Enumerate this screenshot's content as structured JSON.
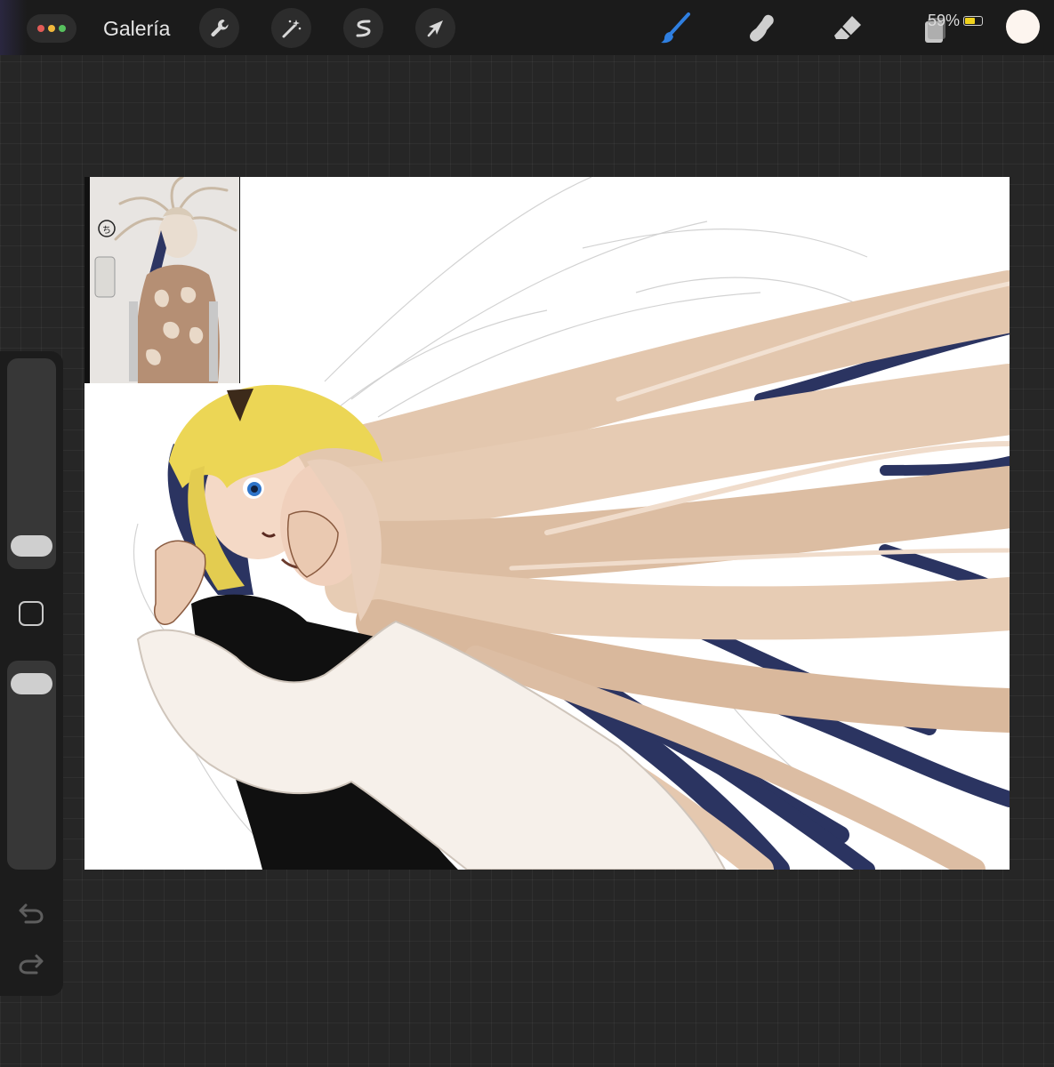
{
  "toolbar": {
    "gallery_label": "Galería",
    "menu_dots": [
      "#e25b57",
      "#f1b83c",
      "#57c15e"
    ],
    "left_tools": [
      {
        "name": "actions",
        "icon": "wrench-icon"
      },
      {
        "name": "adjustments",
        "icon": "magic-wand-icon"
      },
      {
        "name": "selection",
        "icon": "selection-s-icon"
      },
      {
        "name": "transform",
        "icon": "arrow-cursor-icon"
      }
    ],
    "right_tools": [
      {
        "name": "brush",
        "icon": "brush-icon",
        "active": true,
        "color": "#2f7fe0"
      },
      {
        "name": "smudge",
        "icon": "smudge-finger-icon"
      },
      {
        "name": "eraser",
        "icon": "eraser-icon"
      },
      {
        "name": "layers",
        "icon": "layers-icon"
      }
    ],
    "current_color": "#fdf5ef"
  },
  "status": {
    "battery_text": "59%",
    "battery_level": 0.59
  },
  "sidebar": {
    "brush_size_level": 0.05,
    "opacity_level": 0.95,
    "icons": [
      "modify-square-icon",
      "undo-icon",
      "redo-icon"
    ]
  }
}
